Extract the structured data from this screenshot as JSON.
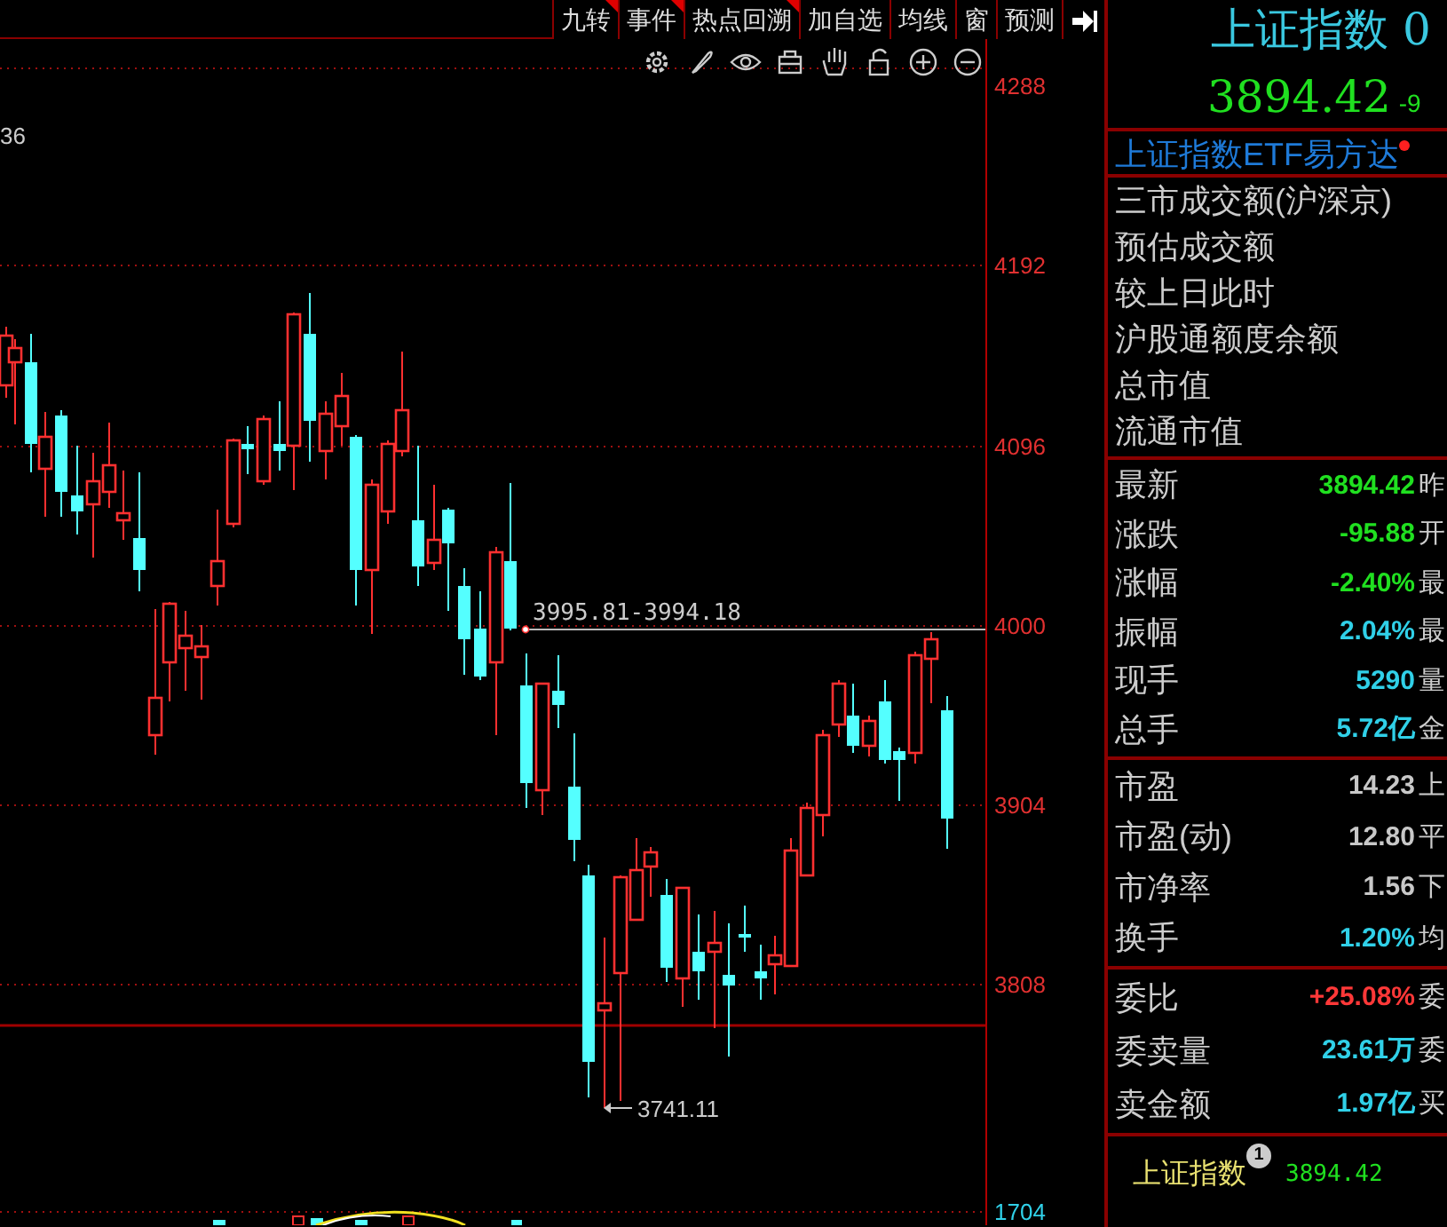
{
  "toolbar": {
    "buttons": [
      {
        "label": "九转",
        "marked": true
      },
      {
        "label": "事件",
        "marked": true
      },
      {
        "label": "热点回溯",
        "marked": true
      },
      {
        "label": "加自选",
        "marked": false
      },
      {
        "label": "均线",
        "marked": false
      },
      {
        "label": "窗",
        "marked": false
      },
      {
        "label": "预测",
        "marked": false
      }
    ]
  },
  "chart": {
    "cut_label": "36",
    "y_ticks": [
      "4288",
      "4192",
      "4096",
      "4000",
      "3904",
      "3808"
    ],
    "range_label": "3995.81-3994.18",
    "low_label": "3741.11",
    "volume_tick": "1704"
  },
  "quote": {
    "title": "上证指数 0",
    "price": "3894.42",
    "change": "-9",
    "etf_link": "上证指数ETF易方达",
    "etf_alert": true
  },
  "turnover_labels": [
    "三市成交额(沪深京)",
    "预估成交额",
    "较上日此时",
    "沪股通额度余额",
    "总市值",
    "流通市值"
  ],
  "sections": [
    [
      {
        "label": "最新",
        "value": "3894.42",
        "color": "#20e020",
        "next": "昨"
      },
      {
        "label": "涨跌",
        "value": "-95.88",
        "color": "#20e020",
        "next": "开"
      },
      {
        "label": "涨幅",
        "value": "-2.40%",
        "color": "#20e020",
        "next": "最"
      },
      {
        "label": "振幅",
        "value": "2.04%",
        "color": "#30d0e8",
        "next": "最"
      },
      {
        "label": "现手",
        "value": "5290",
        "color": "#30d0e8",
        "next": "量"
      },
      {
        "label": "总手",
        "value": "5.72亿",
        "color": "#30d0e8",
        "next": "金"
      }
    ],
    [
      {
        "label": "市盈",
        "value": "14.23",
        "color": "#c8c8c8",
        "next": "上"
      },
      {
        "label": "市盈(动)",
        "value": "12.80",
        "color": "#c8c8c8",
        "next": "平"
      },
      {
        "label": "市净率",
        "value": "1.56",
        "color": "#c8c8c8",
        "next": "下"
      },
      {
        "label": "换手",
        "value": "1.20%",
        "color": "#30d0e8",
        "next": "均"
      }
    ],
    [
      {
        "label": "委比",
        "value": "+25.08%",
        "color": "#ff3838",
        "next": "委"
      },
      {
        "label": "委卖量",
        "value": "23.61万",
        "color": "#30d0e8",
        "next": "委"
      },
      {
        "label": "卖金额",
        "value": "1.97亿",
        "color": "#30d0e8",
        "next": "买"
      }
    ]
  ],
  "footer": {
    "name": "上证指数",
    "badge": "1",
    "price": "3894.42"
  }
}
